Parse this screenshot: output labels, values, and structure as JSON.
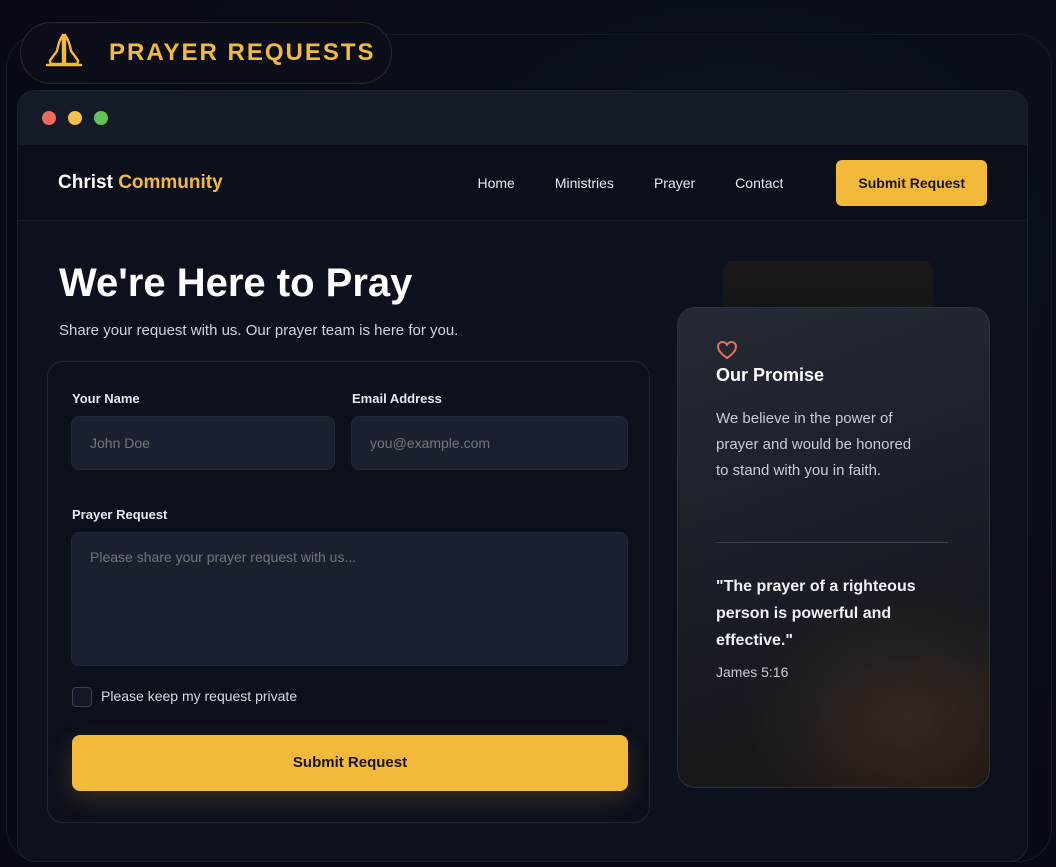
{
  "badge": {
    "icon": "praying-hands-icon",
    "title": "PRAYER REQUESTS"
  },
  "window": {
    "traffic_lights": [
      "#ec6a5e",
      "#f4bf4f",
      "#61c554"
    ]
  },
  "navbar": {
    "brand_main": "Christ ",
    "brand_accent": "Community",
    "links": [
      "Home",
      "Ministries",
      "Prayer",
      "Contact"
    ],
    "cta": "Submit Request"
  },
  "hero": {
    "title": "We're Here to Pray",
    "subtitle": "Share your request with us. Our prayer team is here for you."
  },
  "form": {
    "name_label": "Your Name",
    "name_placeholder": "John Doe",
    "email_label": "Email Address",
    "email_placeholder": "you@example.com",
    "request_label": "Prayer Request",
    "request_placeholder": "Please share your prayer request with us...",
    "private_label": "Please keep my request private",
    "private_checked": false,
    "submit": "Submit Request"
  },
  "promise": {
    "icon": "heart-icon",
    "heading": "Our Promise",
    "body": "We believe in the power of prayer and would be honored to stand with you in faith.",
    "quote": "\"The prayer of a righteous person is powerful and effective.\"",
    "reference": "James 5:16"
  },
  "colors": {
    "accent": "#f2b93b",
    "heart": "#e8705a",
    "background": "#070a14"
  }
}
